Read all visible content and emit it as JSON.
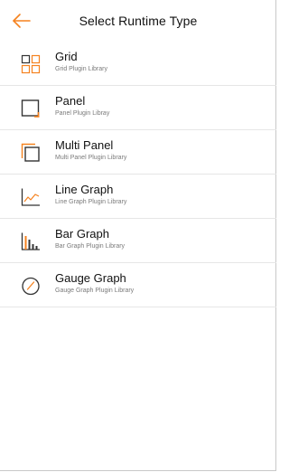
{
  "header": {
    "title": "Select Runtime Type"
  },
  "colors": {
    "accent": "#f5821f",
    "icon": "#333333",
    "divider": "#e6e6e6"
  },
  "items": [
    {
      "label": "Grid",
      "sub": "Grid Plugin Library",
      "icon": "grid-icon"
    },
    {
      "label": "Panel",
      "sub": "Panel Plugin Libray",
      "icon": "panel-icon"
    },
    {
      "label": "Multi Panel",
      "sub": "Multi Panel Plugin Library",
      "icon": "multi-panel-icon"
    },
    {
      "label": "Line Graph",
      "sub": "Line Graph Plugin Library",
      "icon": "line-graph-icon"
    },
    {
      "label": "Bar Graph",
      "sub": "Bar Graph Plugin Library",
      "icon": "bar-graph-icon"
    },
    {
      "label": "Gauge Graph",
      "sub": "Gauge Graph Plugin Library",
      "icon": "gauge-graph-icon"
    }
  ]
}
